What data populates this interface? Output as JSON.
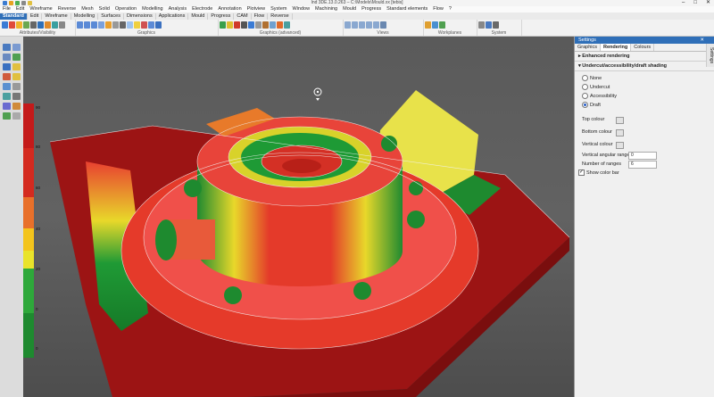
{
  "window": {
    "title": "Ind 3DE.13.0.263 – C:\\Models\\Mould.xx [tebis]",
    "controls": [
      "–",
      "□",
      "✕"
    ]
  },
  "menu": [
    "File",
    "Edit",
    "Wireframe",
    "Reverse",
    "Mesh",
    "Solid",
    "Operation",
    "Modelling",
    "Analysis",
    "Electrode",
    "Annotation",
    "Plotview",
    "System",
    "Window",
    "Machining",
    "Mould",
    "Progress",
    "Standard elements",
    "Flow",
    "?"
  ],
  "tabs": [
    {
      "label": "Standard",
      "active": true
    },
    {
      "label": "Edit"
    },
    {
      "label": "Wireframe"
    },
    {
      "label": "Modelling"
    },
    {
      "label": "Surfaces"
    },
    {
      "label": "Dimensions"
    },
    {
      "label": "Applications"
    },
    {
      "label": "Mould"
    },
    {
      "label": "Progress"
    },
    {
      "label": "CAM"
    },
    {
      "label": "Flow"
    },
    {
      "label": "Reverse"
    }
  ],
  "ribbon_groups": [
    "Attributes/Visibility",
    "Graphics",
    "Graphics (advanced)",
    "Views",
    "Workplanes",
    "System"
  ],
  "colorbar": {
    "ticks": [
      "90",
      "80",
      "60",
      "40",
      "20",
      "0",
      "0"
    ],
    "colors": [
      "#c41a1a",
      "#d42a1f",
      "#e8702a",
      "#f3c41c",
      "#e9e32a",
      "#2ea83a",
      "#1e8a2f"
    ]
  },
  "settings": {
    "title": "Settings",
    "tabs": [
      {
        "label": "Graphics"
      },
      {
        "label": "Rendering",
        "active": true
      },
      {
        "label": "Colours"
      }
    ],
    "side_tab": "Settings",
    "enhanced_rendering": "Enhanced rendering",
    "section": "Undercut/accessibility/draft shading",
    "options": [
      {
        "label": "None"
      },
      {
        "label": "Undercut"
      },
      {
        "label": "Accessibility"
      },
      {
        "label": "Draft",
        "selected": true
      }
    ],
    "top_colour": "Top colour",
    "bottom_colour": "Bottom colour",
    "vertical_colour": "Vertical colour",
    "vertical_angular_range_label": "Vertical angular range",
    "vertical_angular_range": "0",
    "number_of_ranges_label": "Number of ranges",
    "number_of_ranges": "6",
    "show_color_bar": "Show color bar"
  },
  "accent": "#2f6fb8"
}
